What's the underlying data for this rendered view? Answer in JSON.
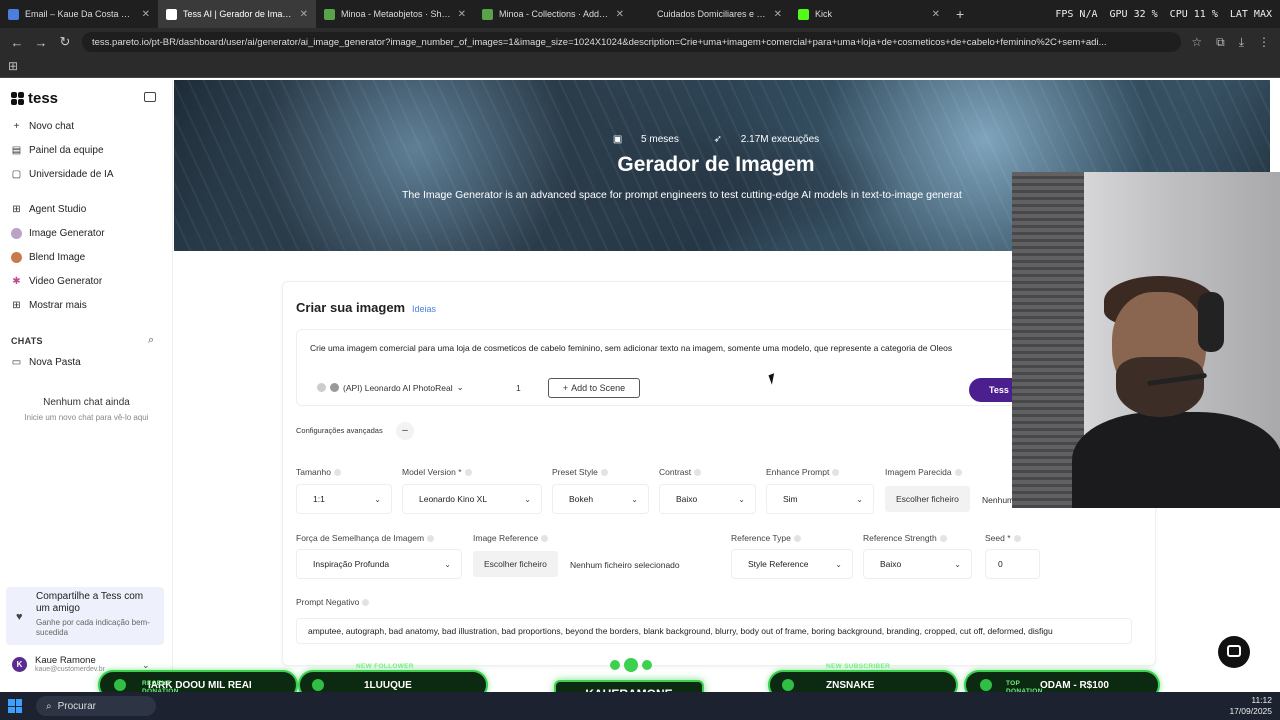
{
  "browser": {
    "tabs": [
      {
        "title": "Email – Kaue Da Costa Pacheco",
        "color": "#4a7fe0",
        "active": false
      },
      {
        "title": "Tess AI | Gerador de Imagem",
        "color": "#ffffff",
        "active": true
      },
      {
        "title": "Minoa - Metaobjetos · Shopify",
        "color": "#5aa34a",
        "active": false
      },
      {
        "title": "Minoa - Collections · Add collec",
        "color": "#5aa34a",
        "active": false
      },
      {
        "title": "Cuidados Domiciliares e Profiss",
        "color": "#1f1f1f",
        "active": false
      },
      {
        "title": "Kick",
        "color": "#53fc18",
        "active": false
      }
    ],
    "new_tab": "+",
    "stats": [
      "FPS N/A",
      "GPU 32 %",
      "CPU 11 %",
      "LAT MAX"
    ],
    "url": "tess.pareto.io/pt-BR/dashboard/user/ai/generator/ai_image_generator?image_number_of_images=1&image_size=1024X1024&description=Crie+uma+imagem+comercial+para+uma+loja+de+cosmeticos+de+cabelo+feminino%2C+sem+adi..."
  },
  "sidebar": {
    "logo": "tess",
    "items": [
      {
        "label": "Novo chat",
        "icon": "plus-icon"
      },
      {
        "label": "Painel da equipe",
        "icon": "team-icon"
      },
      {
        "label": "Universidade de IA",
        "icon": "book-icon"
      },
      {
        "label": "Agent Studio",
        "icon": "grid-icon"
      },
      {
        "label": "Image Generator",
        "icon": "image-generator-icon"
      },
      {
        "label": "Blend Image",
        "icon": "blend-icon"
      },
      {
        "label": "Video Generator",
        "icon": "video-icon"
      },
      {
        "label": "Mostrar mais",
        "icon": "more-icon"
      }
    ],
    "chats_heading": "CHATS",
    "new_folder": "Nova Pasta",
    "empty_title": "Nenhum chat ainda",
    "empty_sub": "Inicie um novo chat para vê-lo aqui",
    "share_title": "Compartilhe a Tess com um amigo",
    "share_sub": "Ganhe por cada indicação bem-sucedida",
    "user_initial": "K",
    "user_name": "Kaue Ramone",
    "user_email": "kaue@customerdev.br"
  },
  "hero": {
    "age": "5 meses",
    "executions": "2.17M execuções",
    "title": "Gerador de Imagem",
    "description": "The Image Generator is an advanced space for prompt engineers to test cutting-edge AI models in text-to-image generat"
  },
  "form": {
    "title": "Criar sua imagem",
    "ideas": "Ideias",
    "prompt": "Crie uma imagem comercial para uma loja de cosmeticos de cabelo feminino, sem adicionar texto na imagem, somente uma modelo,  que represente a categoria de Oleos",
    "model": "(API) Leonardo AI PhotoReal",
    "count": "1",
    "add_scene": "Add to Scene",
    "generate": "Tess",
    "advanced": "Configurações avançadas",
    "advanced_toggle": "–",
    "size_label": "Tamanho",
    "size_value": "1:1",
    "model_version_label": "Model Version *",
    "model_version_value": "Leonardo Kino XL",
    "preset_label": "Preset Style",
    "preset_value": "Bokeh",
    "contrast_label": "Contrast",
    "contrast_value": "Baixo",
    "enhance_label": "Enhance Prompt",
    "enhance_value": "Sim",
    "similar_label": "Imagem Parecida",
    "similar_file_btn": "Escolher ficheiro",
    "similar_file_none": "Nenhum",
    "strength_label": "Força de Semelhança de Imagem",
    "strength_value": "Inspiração Profunda",
    "ref_label": "Image Reference",
    "ref_file_btn": "Escolher ficheiro",
    "ref_file_none": "Nenhum ficheiro selecionado",
    "ref_type_label": "Reference Type",
    "ref_type_value": "Style Reference",
    "ref_strength_label": "Reference Strength",
    "ref_strength_value": "Baixo",
    "seed_label": "Seed *",
    "seed_value": "0",
    "negative_label": "Prompt Negativo",
    "negative_value": "amputee, autograph, bad anatomy, bad illustration, bad proportions, beyond the borders, blank background, blurry, body out of frame, boring background, branding, cropped, cut off, deformed, disfigu"
  },
  "overlay": {
    "recent_label": "RECENT DONATION",
    "recent_value": "IARK DOOU MIL REAI",
    "follower_label": "NEW FOLLOWER",
    "follower_value": "1LUUQUE",
    "streamer": "KAUERAMONE",
    "subscriber_label": "NEW SUBSCRIBER",
    "subscriber_value": "ZNSNAKE",
    "top_label": "TOP DONATION",
    "top_value": "ODAM - R$100"
  },
  "taskbar": {
    "search": "Procurar",
    "time": "11:12",
    "date": "17/09/2025"
  },
  "colors": {
    "accent": "#4c1f8f",
    "overlay_green": "#3bd14f",
    "link": "#4a7fe0"
  }
}
